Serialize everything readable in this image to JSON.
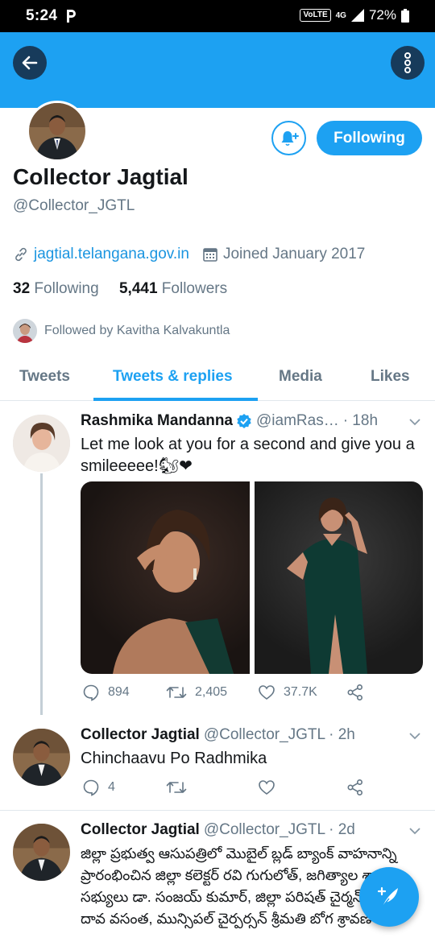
{
  "status_bar": {
    "time": "5:24",
    "volte": "VoLTE",
    "network": "4G",
    "battery": "72%"
  },
  "colors": {
    "brand": "#1da1f2",
    "link": "#1b95e0",
    "secondary_text": "#657786",
    "like_red": "#e0245e"
  },
  "profile": {
    "name": "Collector Jagtial",
    "handle": "@Collector_JGTL",
    "follow_button": "Following",
    "website": "jagtial.telangana.gov.in",
    "joined": "Joined January 2017",
    "following_count": "32",
    "following_label": "Following",
    "followers_count": "5,441",
    "followers_label": "Followers",
    "followed_by": "Followed by Kavitha Kalvakuntla"
  },
  "tabs": [
    {
      "label": "Tweets"
    },
    {
      "label": "Tweets & replies"
    },
    {
      "label": "Media"
    },
    {
      "label": "Likes"
    }
  ],
  "tweets": [
    {
      "name": "Rashmika Mandanna",
      "handle": "@iamRas…",
      "time": "· 18h",
      "text": "Let me look at you for a second and give you a smileeeee!🐿❤",
      "replies": "894",
      "retweets": "2,405",
      "likes": "37.7K"
    },
    {
      "name": "Collector Jagtial",
      "handle": "@Collector_JGTL",
      "time": "· 2h",
      "text": "Chinchaavu Po Radhmika",
      "replies": "4"
    },
    {
      "name": "Collector Jagtial",
      "handle": "@Collector_JGTL",
      "time": "· 2d",
      "text": "జిల్లా ప్రభుత్వ ఆసుపత్రిలో మొబైల్ బ్లడ్ బ్యాంక్ వాహనాన్ని ప్రారంభించిన జిల్లా కలెక్టర్ రవి గుగులోత్, జగిత్యాల శాసన సభ్యులు డా. సంజయ్ కుమార్, జిల్లా పరిషత్ చైర్మన్ శ్రీమతి దావ వసంత, మున్సిపల్ చైర్పర్సన్ శ్రీమతి బోగ శ్రావణి"
    }
  ]
}
